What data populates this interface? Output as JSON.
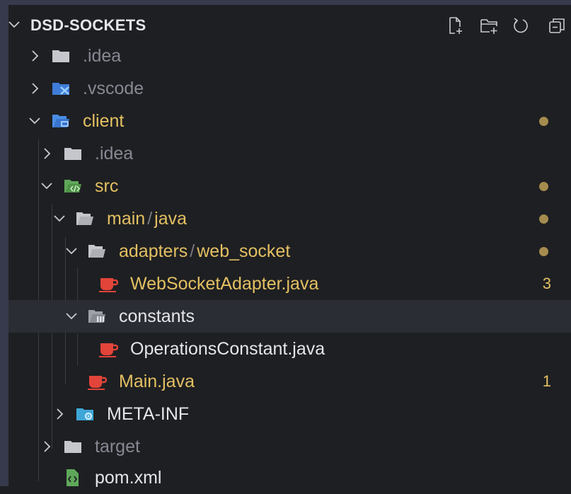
{
  "explorer": {
    "root_label": "DSD-SOCKETS",
    "actions": [
      {
        "name": "new-file-icon"
      },
      {
        "name": "new-folder-icon"
      },
      {
        "name": "refresh-icon"
      },
      {
        "name": "collapse-all-icon"
      }
    ]
  },
  "tree": {
    "idea_root": {
      "label": ".idea",
      "icon": "folder-icon"
    },
    "vscode": {
      "label": ".vscode",
      "icon": "vscode-folder-icon"
    },
    "client": {
      "label": "client",
      "icon": "client-folder-icon",
      "status": "modified-dot"
    },
    "client_idea": {
      "label": ".idea",
      "icon": "folder-icon"
    },
    "src": {
      "label": "src",
      "icon": "src-folder-icon",
      "status": "modified-dot"
    },
    "main_java": {
      "part1": "main",
      "separator": "/",
      "part2": "java",
      "icon": "folder-open-icon",
      "status": "modified-dot"
    },
    "adapters": {
      "part1": "adapters",
      "separator": "/",
      "part2": "web_socket",
      "icon": "folder-open-icon",
      "status": "modified-dot"
    },
    "websocket_adapter": {
      "label": "WebSocketAdapter.java",
      "icon": "java-file-icon",
      "badge": "3"
    },
    "constants": {
      "label": "constants",
      "icon": "constants-folder-icon"
    },
    "operations_constant": {
      "label": "OperationsConstant.java",
      "icon": "java-file-icon"
    },
    "main": {
      "label": "Main.java",
      "icon": "java-file-icon",
      "badge": "1"
    },
    "meta_inf": {
      "label": "META-INF",
      "icon": "config-folder-icon"
    },
    "target": {
      "label": "target",
      "icon": "folder-icon"
    },
    "pom": {
      "label": "pom.xml",
      "icon": "xml-file-icon"
    }
  },
  "colors": {
    "background": "#1e1f22",
    "frame": "#363a4c",
    "modified": "#e3c062",
    "error": "#f06a55",
    "ignored": "#868993",
    "selected_row": "#2b2d34"
  }
}
